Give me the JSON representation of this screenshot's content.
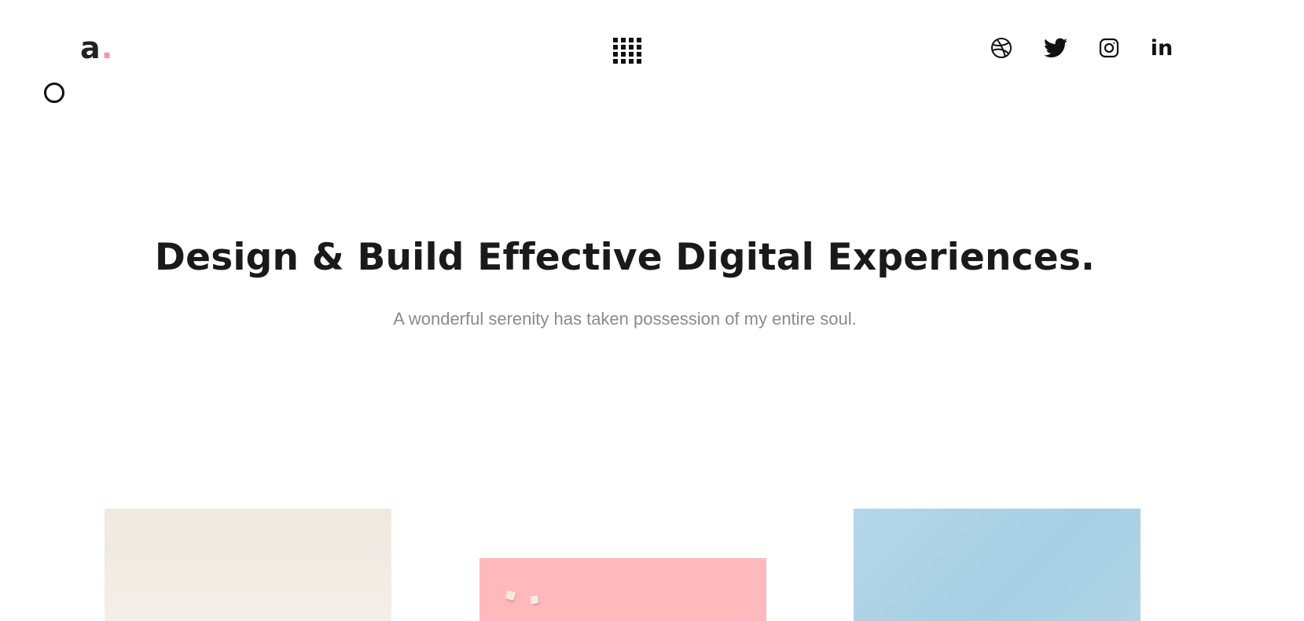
{
  "header": {
    "logo": {
      "letter": "a",
      "dot": "."
    },
    "menu_icon": "grid-menu-icon",
    "social": [
      {
        "name": "dribbble",
        "icon": "dribbble-icon"
      },
      {
        "name": "twitter",
        "icon": "twitter-icon"
      },
      {
        "name": "instagram",
        "icon": "instagram-icon"
      },
      {
        "name": "linkedin",
        "icon": "linkedin-icon",
        "label": "in"
      }
    ]
  },
  "hero": {
    "title": "Design & Build Effective Digital Experiences.",
    "subtitle": "A wonderful serenity has taken possession of my entire soul."
  },
  "portfolio": {
    "cards": [
      {
        "name": "project-card-1",
        "color": "#efe9df"
      },
      {
        "name": "project-card-2",
        "color": "#ffb8bc"
      },
      {
        "name": "project-card-3",
        "color": "#b4d6e9"
      }
    ]
  },
  "colors": {
    "accent": "#ff8fb0",
    "text_dark": "#1a1a1a",
    "text_muted": "#8a8a8a"
  }
}
